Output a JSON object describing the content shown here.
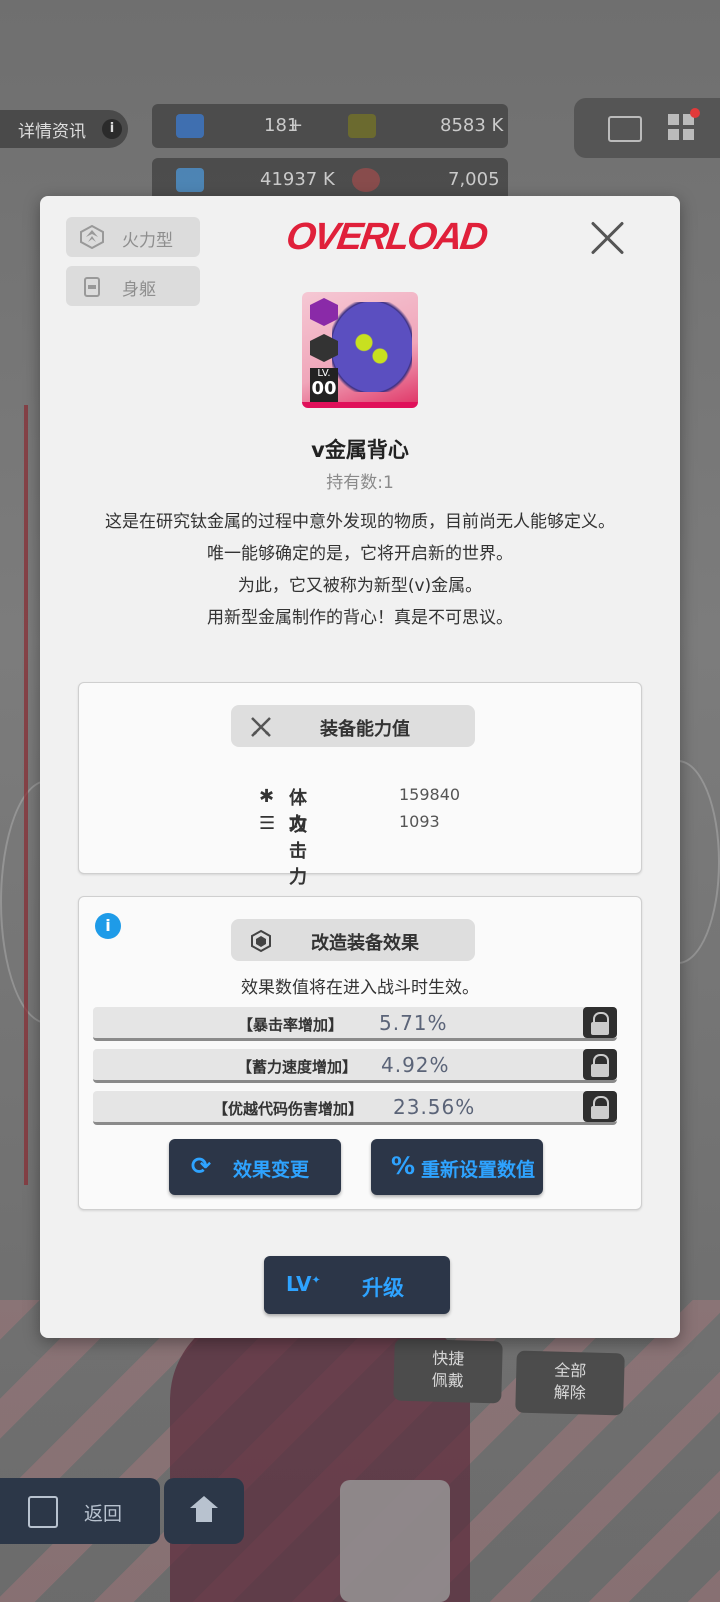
{
  "hud": {
    "detail_tab": "详情资讯",
    "info_glyph": "i",
    "res1_value": "181",
    "res1_plus": "+",
    "res2_value": "8583 K",
    "res3_value": "41937 K",
    "res4_value": "7,005"
  },
  "modal": {
    "logo": "OVERLOAD",
    "tags": [
      {
        "label": "火力型",
        "icon": "firepower-icon"
      },
      {
        "label": "身躯",
        "icon": "body-armor-icon"
      }
    ],
    "item": {
      "name": "v金属背心",
      "owned": "持有数:1",
      "lv_label": "LV.",
      "lv_value": "00",
      "description": [
        "这是在研究钛金属的过程中意外发现的物质，目前尚无人能够定义。",
        "唯一能够确定的是，它将开启新的世界。",
        "为此，它又被称为新型(v)金属。",
        "用新型金属制作的背心！真是不可思议。"
      ]
    },
    "stats_panel": {
      "title": "装备能力值",
      "stats": [
        {
          "label": "体力",
          "value": "159840",
          "icon": "health-icon"
        },
        {
          "label": "攻击力",
          "value": "1093",
          "icon": "attack-icon"
        }
      ]
    },
    "effects_panel": {
      "title": "改造装备效果",
      "note": "效果数值将在进入战斗时生效。",
      "effects": [
        {
          "label": "【暴击率增加】",
          "value": "5.71%"
        },
        {
          "label": "【蓄力速度增加】",
          "value": "4.92%"
        },
        {
          "label": "【优越代码伤害增加】",
          "value": "23.56%"
        }
      ],
      "change_button": "效果变更",
      "reset_button": "重新设置数值"
    },
    "upgrade": {
      "lv_label": "LV",
      "label": "升级"
    }
  },
  "bottom": {
    "back_label": "返回",
    "quick_equip": [
      "快捷",
      "佩戴"
    ],
    "remove_all": [
      "全部",
      "解除"
    ]
  },
  "colors": {
    "accent_blue": "#2ea3ff",
    "logo_red": "#e0203a",
    "button_dark": "#2c3648"
  }
}
